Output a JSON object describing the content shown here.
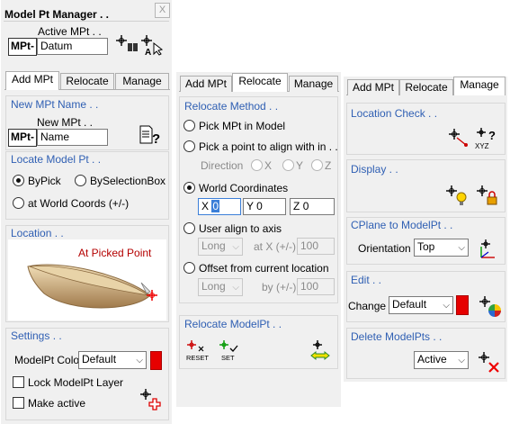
{
  "window": {
    "title": "Model Pt Manager . .",
    "close_label": "X"
  },
  "active_mpt": {
    "label": "Active MPt . .",
    "prefix": "MPt-",
    "value": "Datum"
  },
  "panel_add": {
    "tabs": [
      "Add MPt",
      "Relocate",
      "Manage"
    ],
    "new_name": {
      "title": "New MPt Name . .",
      "label": "New MPt . .",
      "prefix": "MPt-",
      "value": "Name"
    },
    "locate": {
      "title": "Locate Model Pt . .",
      "options": [
        "ByPick",
        "BySelectionBox",
        "at World Coords (+/-)"
      ],
      "selected": "ByPick"
    },
    "location": {
      "title": "Location . .",
      "caption": "At Picked Point"
    },
    "settings": {
      "title": "Settings . .",
      "color_label": "ModelPt Color",
      "color_value": "Default",
      "color_hex": "#e60000",
      "lock_label": "Lock ModelPt Layer",
      "active_label": "Make active"
    }
  },
  "panel_relocate": {
    "tabs": [
      "Add MPt",
      "Relocate",
      "Manage"
    ],
    "method": {
      "title": "Relocate Method . .",
      "opt_pick": "Pick MPt in Model",
      "opt_align": "Pick a point to align with in . .",
      "direction_label": "Direction",
      "directions": [
        "X",
        "Y",
        "Z"
      ],
      "opt_world": "World Coordinates",
      "x_label": "X",
      "x_value": "0",
      "y_label": "Y",
      "y_value": "0",
      "z_label": "Z",
      "z_value": "0",
      "opt_axis": "User align to axis",
      "axis_select": "Long",
      "axis_at_label": "at X (+/-)",
      "axis_value": "100",
      "opt_offset": "Offset from current location",
      "offset_select": "Long",
      "offset_by_label": "by (+/-)",
      "offset_value": "100",
      "selected": "World Coordinates"
    },
    "relocate": {
      "title": "Relocate ModelPt . .",
      "reset_label": "RESET",
      "set_label": "SET"
    }
  },
  "panel_manage": {
    "tabs": [
      "Add MPt",
      "Relocate",
      "Manage"
    ],
    "location_check": {
      "title": "Location Check . .",
      "xyz_label": "XYZ"
    },
    "display": {
      "title": "Display . ."
    },
    "cplane": {
      "title": "CPlane to ModelPt . .",
      "orientation_label": "Orientation",
      "orientation_value": "Top"
    },
    "edit": {
      "title": "Edit . .",
      "change_label": "Change",
      "change_value": "Default",
      "color_hex": "#e60000"
    },
    "delete": {
      "title": "Delete ModelPts . .",
      "value": "Active"
    }
  }
}
